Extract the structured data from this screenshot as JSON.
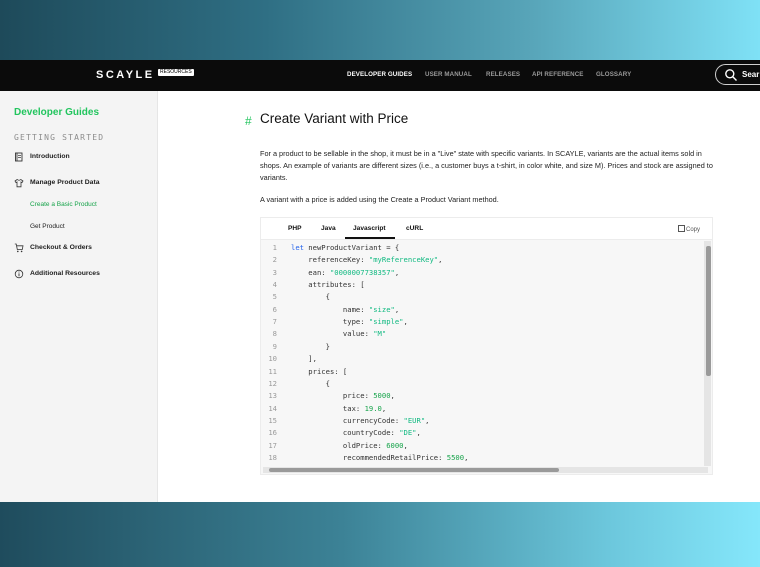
{
  "header": {
    "logo": "SCAYLE",
    "logo_badge": "RESOURCES",
    "nav": [
      "DEVELOPER GUIDES",
      "USER MANUAL",
      "RELEASES",
      "API REFERENCE",
      "GLOSSARY"
    ],
    "search_label": "Sear"
  },
  "sidebar": {
    "title": "Developer Guides",
    "section": "GETTING STARTED",
    "items": [
      {
        "label": "Introduction",
        "icon": "book-icon"
      },
      {
        "label": "Manage Product Data",
        "icon": "shirt-icon"
      },
      {
        "label": "Checkout & Orders",
        "icon": "cart-icon"
      },
      {
        "label": "Additional Resources",
        "icon": "info-icon"
      }
    ],
    "subitems": [
      "Create a Basic Product",
      "Get Product"
    ]
  },
  "main": {
    "heading": "Create Variant with Price",
    "heading_anchor": "#",
    "paragraph1": "For a product to be sellable in the shop, it must be in a \"Live\" state with specific variants. In SCAYLE, variants are the actual items sold in shops. An example of variants are different sizes (i.e., a customer buys a t-shirt, in color white, and size M). Prices and stock are assigned to variants.",
    "paragraph2": "A variant with a price is added using the Create a Product Variant method."
  },
  "code_block": {
    "tabs": [
      "PHP",
      "Java",
      "Javascript",
      "cURL"
    ],
    "active_tab": "Javascript",
    "copy_label": "Copy",
    "line_numbers": [
      "1",
      "2",
      "3",
      "4",
      "5",
      "6",
      "7",
      "8",
      "9",
      "10",
      "11",
      "12",
      "13",
      "14",
      "15",
      "16",
      "17",
      "18"
    ],
    "lines": [
      "let newProductVariant = {",
      "    referenceKey: \"myReferenceKey\",",
      "    ean: \"0000007738357\",",
      "    attributes: [",
      "        {",
      "            name: \"size\",",
      "            type: \"simple\",",
      "            value: \"M\"",
      "        }",
      "    ],",
      "    prices: [",
      "        {",
      "            price: 5000,",
      "            tax: 19.0,",
      "            currencyCode: \"EUR\",",
      "            countryCode: \"DE\",",
      "            oldPrice: 6000,",
      "            recommendedRetailPrice: 5500,"
    ]
  },
  "colors": {
    "accent": "#22c55e",
    "topbar": "#0b0b0b",
    "keyword": "#2563eb",
    "string": "#10b981"
  }
}
